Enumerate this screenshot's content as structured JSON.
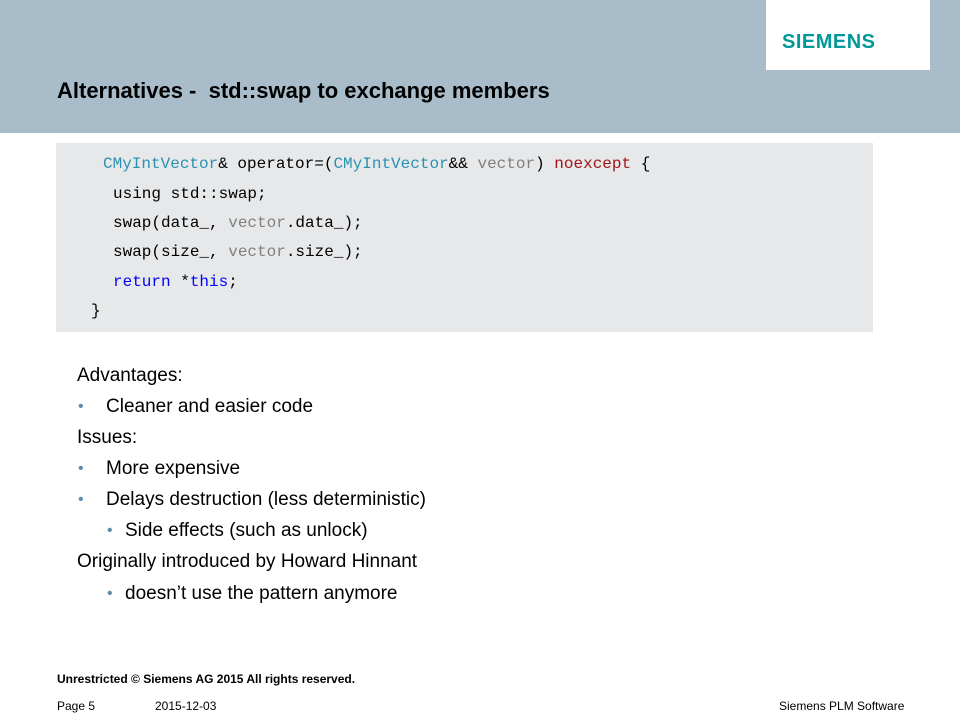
{
  "header": {
    "logo_text": "SIEMENS",
    "title": "Alternatives -  std::swap to exchange members"
  },
  "code": {
    "lines": [
      [
        {
          "t": "CMyIntVector",
          "c": "t"
        },
        {
          "t": "& operator=(",
          "c": "n"
        },
        {
          "t": "CMyIntVector",
          "c": "t"
        },
        {
          "t": "&& ",
          "c": "n"
        },
        {
          "t": "vector",
          "c": "p"
        },
        {
          "t": ") ",
          "c": "n"
        },
        {
          "t": "noexcept",
          "c": "r"
        },
        {
          "t": " {",
          "c": "n"
        }
      ],
      [
        {
          "t": "using std::swap;",
          "c": "n"
        }
      ],
      [
        {
          "t": "swap(data_, ",
          "c": "n"
        },
        {
          "t": "vector",
          "c": "p"
        },
        {
          "t": ".data_);",
          "c": "n"
        }
      ],
      [
        {
          "t": "swap(size_, ",
          "c": "n"
        },
        {
          "t": "vector",
          "c": "p"
        },
        {
          "t": ".size_);",
          "c": "n"
        }
      ],
      [
        {
          "t": "return",
          "c": "k"
        },
        {
          "t": " *",
          "c": "n"
        },
        {
          "t": "this",
          "c": "k"
        },
        {
          "t": ";",
          "c": "n"
        }
      ],
      [
        {
          "t": "}",
          "c": "n"
        }
      ]
    ]
  },
  "body": {
    "advantages_label": "Advantages:",
    "advantage_1": "Cleaner and easier code",
    "issues_label": "Issues:",
    "issue_1": "More expensive",
    "issue_2": "Delays destruction (less deterministic)",
    "issue_2_sub": "Side effects (such as unlock)",
    "origin_label": "Originally introduced by Howard Hinnant",
    "origin_sub": "doesn’t use the pattern anymore",
    "bullet_glyph": "•"
  },
  "footer": {
    "classification": "Unrestricted © Siemens AG 2015 All rights reserved.",
    "page": "Page 5",
    "date": "2015-12-03",
    "company": "Siemens PLM Software"
  },
  "colors": {
    "header_band": "#a9bcc9",
    "logo": "#009999",
    "code_bg": "#e6e8ea",
    "bullet": "#5f8caa",
    "code_type": "#2b91af",
    "code_keyword": "#0000ff",
    "code_specifier": "#a31515",
    "code_param": "#808080"
  }
}
